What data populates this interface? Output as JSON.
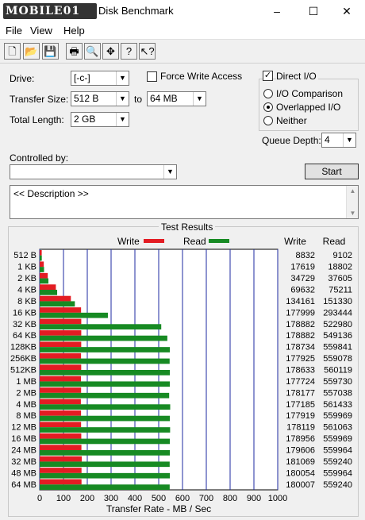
{
  "window": {
    "logo_text": "MOBILE01",
    "title": "Disk Benchmark",
    "minimize_icon": "–",
    "maximize_icon": "☐",
    "close_icon": "✕"
  },
  "menu": [
    "File",
    "View",
    "Help"
  ],
  "toolbar": {
    "icons": [
      "new-file-icon",
      "open-folder-icon",
      "save-icon",
      "print-icon",
      "print-preview-icon",
      "move-icon",
      "help-icon",
      "context-help-icon"
    ],
    "glyphs": [
      "🗋",
      "📂",
      "💾",
      "🖶",
      "🔍",
      "✥",
      "?",
      "↖?"
    ]
  },
  "settings": {
    "drive_label": "Drive:",
    "drive_value": "[-c-]",
    "transfer_size_label": "Transfer Size:",
    "transfer_from": "512 B",
    "to_label": "to",
    "transfer_to": "64 MB",
    "total_length_label": "Total Length:",
    "total_length_value": "2 GB",
    "force_write_label": "Force Write Access",
    "direct_io_label": "Direct I/O",
    "io_comparison_label": "I/O Comparison",
    "overlapped_io_label": "Overlapped I/O",
    "neither_label": "Neither",
    "queue_depth_label": "Queue Depth:",
    "queue_depth_value": "4",
    "controlled_by_label": "Controlled by:",
    "controlled_by_value": "",
    "start_label": "Start",
    "description_text": "<< Description >>",
    "force_write_checked": false,
    "direct_io_checked": true,
    "selected_io_mode": "Overlapped I/O"
  },
  "results": {
    "group_title": "Test Results",
    "write_legend": "Write",
    "read_legend": "Read",
    "write_col_header": "Write",
    "read_col_header": "Read",
    "write_color": "#e31c23",
    "read_color": "#178a23"
  },
  "chart_data": {
    "type": "bar",
    "orientation": "horizontal",
    "categories": [
      "512 B",
      "1 KB",
      "2 KB",
      "4 KB",
      "8 KB",
      "16 KB",
      "32 KB",
      "64 KB",
      "128KB",
      "256KB",
      "512KB",
      "1 MB",
      "2 MB",
      "4 MB",
      "8 MB",
      "12 MB",
      "16 MB",
      "24 MB",
      "32 MB",
      "48 MB",
      "64 MB"
    ],
    "series": [
      {
        "name": "Write",
        "unit": "KB/s",
        "values": [
          8832,
          17619,
          34729,
          69632,
          134161,
          177999,
          178882,
          178882,
          178734,
          177925,
          178633,
          177724,
          178177,
          177185,
          177919,
          178119,
          178956,
          179606,
          181069,
          180054,
          180007
        ]
      },
      {
        "name": "Read",
        "unit": "KB/s",
        "values": [
          9102,
          18802,
          37605,
          75211,
          151330,
          293444,
          522980,
          549136,
          559841,
          559078,
          560119,
          559730,
          557038,
          561433,
          559969,
          561063,
          559969,
          559964,
          559240,
          559964,
          559240
        ]
      }
    ],
    "xlabel": "Transfer Rate - MB / Sec",
    "xlim": [
      0,
      1000
    ],
    "xticks": [
      0,
      100,
      200,
      300,
      400,
      500,
      600,
      700,
      800,
      900,
      1000
    ],
    "grid": true,
    "legend": "top"
  }
}
